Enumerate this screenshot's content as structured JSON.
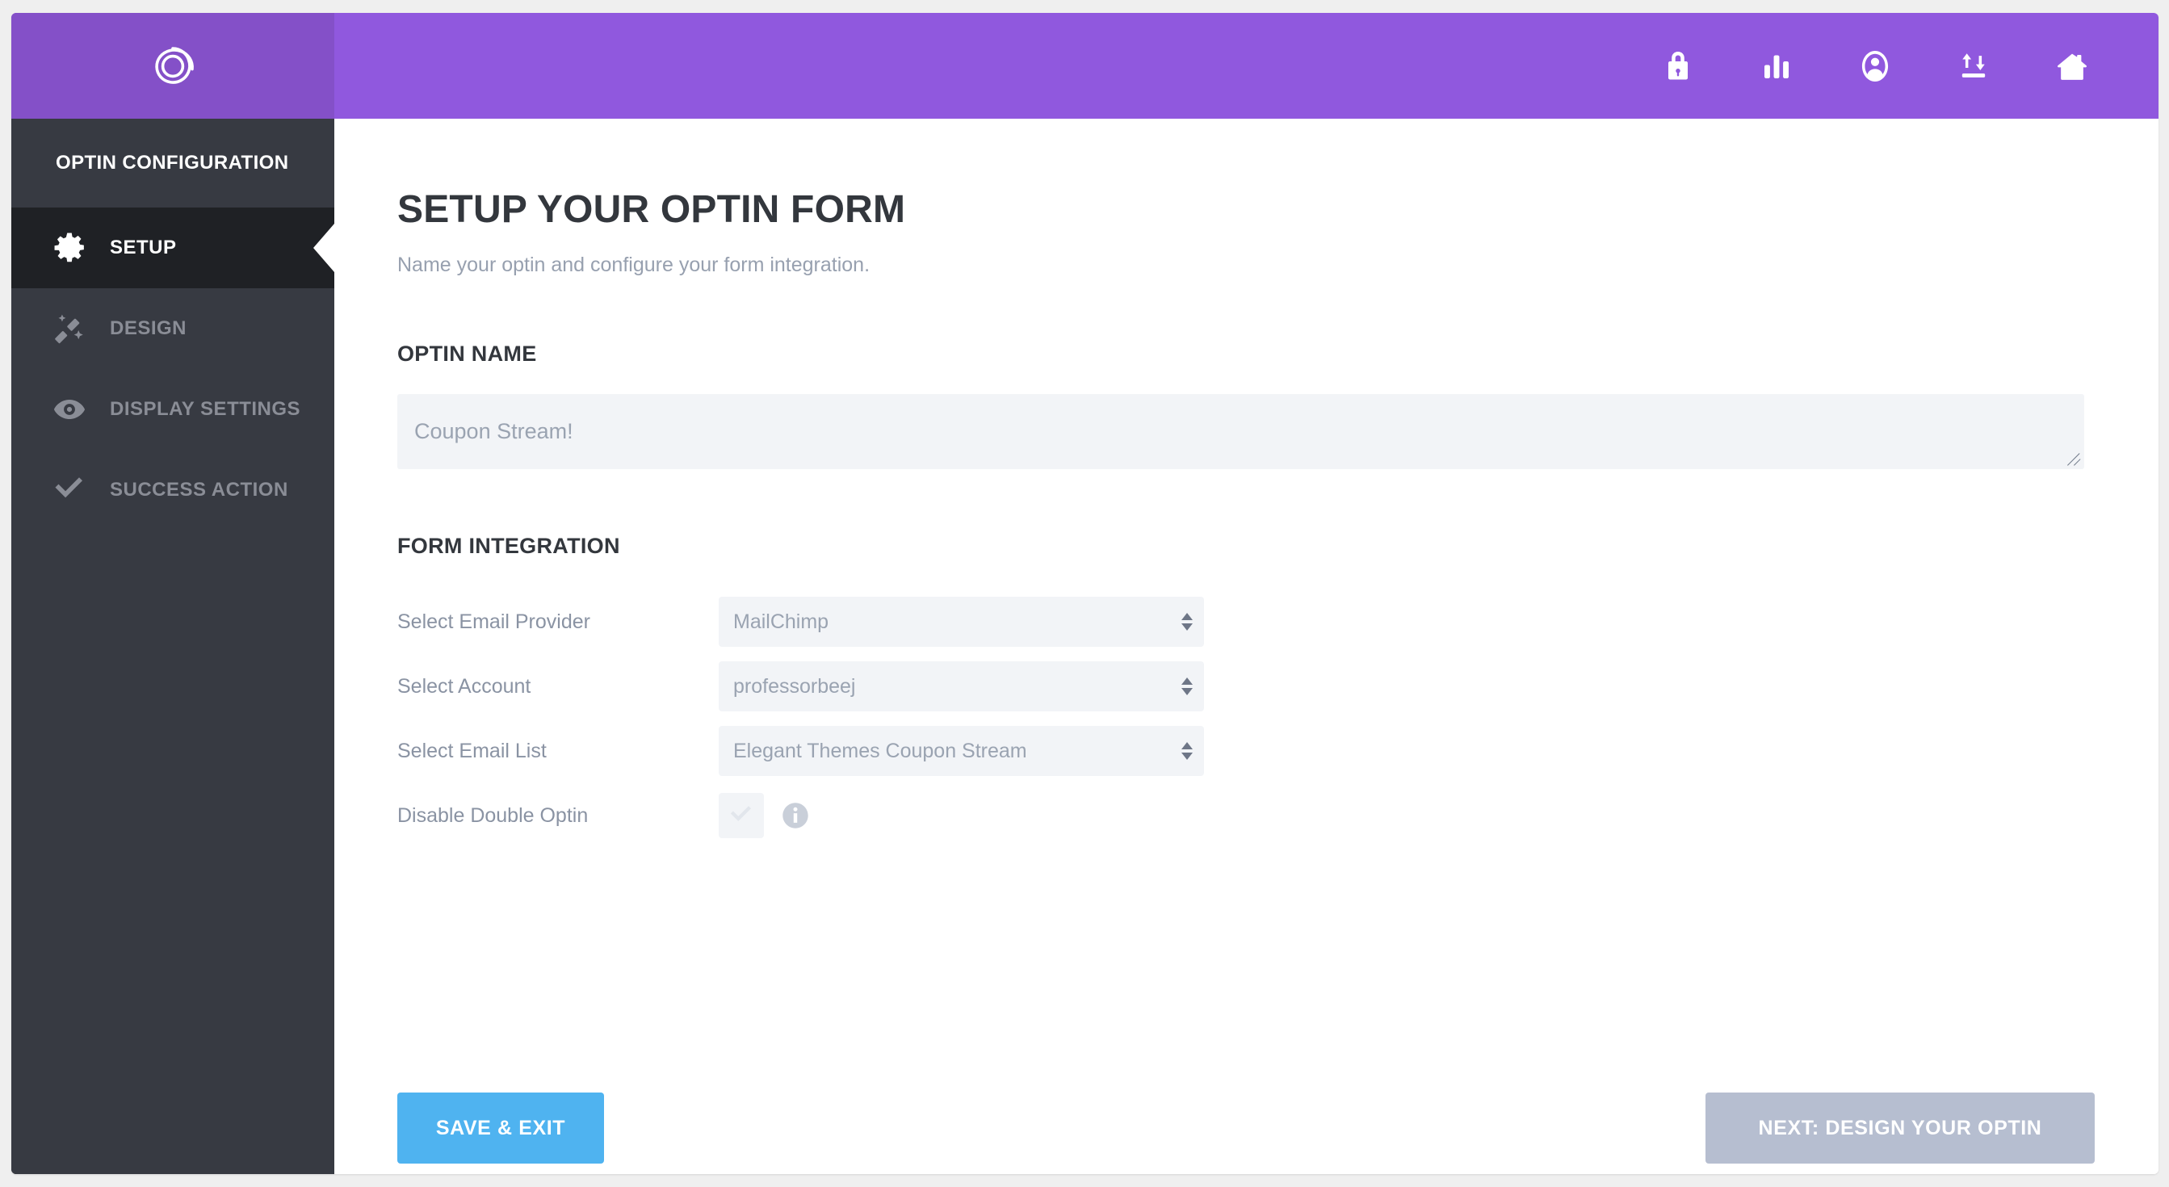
{
  "app": {
    "logo_name": "bloom-logo",
    "header_purple": "#9058DE",
    "logo_purple": "#8450C8",
    "sidebar_dark": "#373A42",
    "sidebar_active_dark": "#1F2125",
    "accent_blue": "#4FB3F0",
    "muted_button": "#B6BED0",
    "field_bg": "#F2F4F7"
  },
  "topbar": {
    "icons": [
      {
        "name": "lock-icon",
        "label": "Lock"
      },
      {
        "name": "bar-chart-icon",
        "label": "Statistics"
      },
      {
        "name": "user-circle-icon",
        "label": "Account"
      },
      {
        "name": "import-export-icon",
        "label": "Import / Export"
      },
      {
        "name": "home-icon",
        "label": "Home"
      }
    ]
  },
  "sidebar": {
    "title": "OPTIN CONFIGURATION",
    "items": [
      {
        "label": "SETUP",
        "icon": "gear-icon",
        "active": true
      },
      {
        "label": "DESIGN",
        "icon": "magic-wand-icon",
        "active": false
      },
      {
        "label": "DISPLAY SETTINGS",
        "icon": "eye-icon",
        "active": false
      },
      {
        "label": "SUCCESS ACTION",
        "icon": "check-icon",
        "active": false
      }
    ]
  },
  "main": {
    "title": "SETUP YOUR OPTIN FORM",
    "subtitle": "Name your optin and configure your form integration.",
    "optin_name": {
      "section_title": "OPTIN NAME",
      "value": "Coupon Stream!",
      "placeholder": "Coupon Stream!"
    },
    "form_integration": {
      "section_title": "FORM INTEGRATION",
      "rows": [
        {
          "label": "Select Email Provider",
          "value": "MailChimp"
        },
        {
          "label": "Select Account",
          "value": "professorbeej"
        },
        {
          "label": "Select Email List",
          "value": "Elegant Themes Coupon Stream"
        }
      ],
      "checkbox_row": {
        "label": "Disable Double Optin",
        "checked": false,
        "info_label": "i"
      }
    },
    "buttons": {
      "save": "SAVE & EXIT",
      "next": "NEXT: DESIGN YOUR OPTIN"
    }
  }
}
